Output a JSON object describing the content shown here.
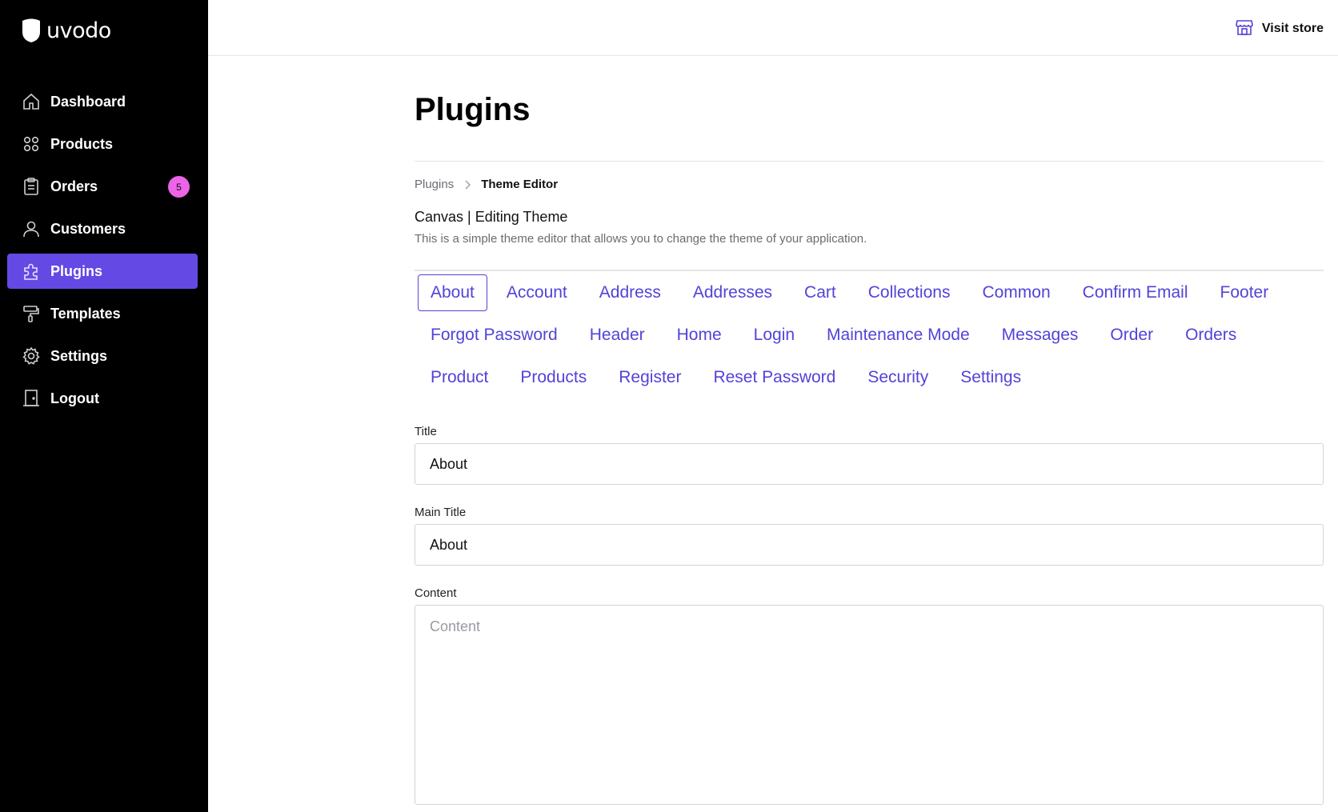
{
  "brand": {
    "name": "uvodo"
  },
  "sidebar": {
    "items": [
      {
        "label": "Dashboard",
        "icon": "home-icon"
      },
      {
        "label": "Products",
        "icon": "grid-icon"
      },
      {
        "label": "Orders",
        "icon": "clipboard-icon",
        "badge": "5"
      },
      {
        "label": "Customers",
        "icon": "user-icon"
      },
      {
        "label": "Plugins",
        "icon": "puzzle-icon",
        "active": true
      },
      {
        "label": "Templates",
        "icon": "paint-roller-icon"
      },
      {
        "label": "Settings",
        "icon": "gear-icon"
      },
      {
        "label": "Logout",
        "icon": "door-icon"
      }
    ]
  },
  "topbar": {
    "visit_store_label": "Visit store",
    "visit_store_icon": "store-icon"
  },
  "page": {
    "title": "Plugins",
    "breadcrumb": {
      "parent": "Plugins",
      "current": "Theme Editor"
    },
    "section_title": "Canvas | Editing Theme",
    "section_desc": "This is a simple theme editor that allows you to change the theme of your application."
  },
  "tabs": [
    "About",
    "Account",
    "Address",
    "Addresses",
    "Cart",
    "Collections",
    "Common",
    "Confirm Email",
    "Footer",
    "Forgot Password",
    "Header",
    "Home",
    "Login",
    "Maintenance Mode",
    "Messages",
    "Order",
    "Orders",
    "Product",
    "Products",
    "Register",
    "Reset Password",
    "Security",
    "Settings"
  ],
  "active_tab": "About",
  "form": {
    "title": {
      "label": "Title",
      "value": "About"
    },
    "main_title": {
      "label": "Main Title",
      "value": "About"
    },
    "content": {
      "label": "Content",
      "placeholder": "Content",
      "value": ""
    }
  },
  "colors": {
    "accent": "#6549e5",
    "tab_text": "#5243d8",
    "badge": "#ec64e8",
    "sidebar_bg": "#000000"
  }
}
